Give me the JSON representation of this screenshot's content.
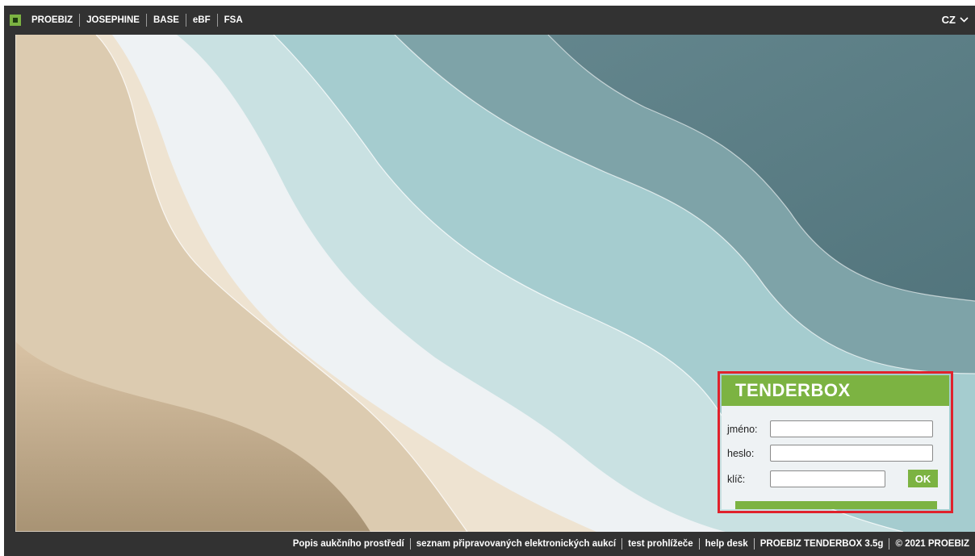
{
  "topnav": {
    "items": [
      "PROEBIZ",
      "JOSEPHINE",
      "BASE",
      "eBF",
      "FSA"
    ],
    "language": "CZ"
  },
  "login": {
    "title": "TENDERBOX",
    "username_label": "jméno:",
    "password_label": "heslo:",
    "key_label": "klíč:",
    "submit_label": "OK"
  },
  "footer": {
    "links": [
      "Popis aukčního prostředí",
      "seznam připravovaných elektronických aukcí",
      "test prohlížeče",
      "help desk",
      "PROEBIZ TENDERBOX 3.5g",
      "© 2021 PROEBIZ"
    ]
  },
  "colors": {
    "accent_green": "#7cb342",
    "bar_dark": "#323232",
    "highlight_red": "#e0222c"
  }
}
